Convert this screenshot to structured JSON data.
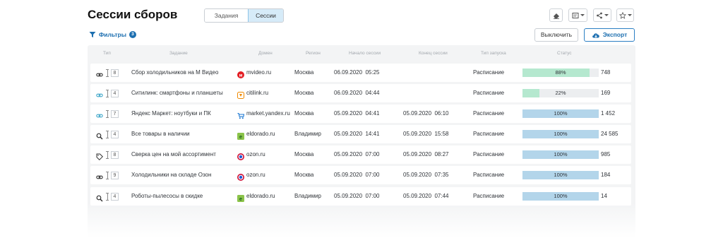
{
  "header": {
    "title": "Сессии сборов",
    "tabs": [
      {
        "label": "Задания",
        "active": false
      },
      {
        "label": "Сессии",
        "active": true
      }
    ]
  },
  "toolbar": {
    "icons": [
      "eraser-icon",
      "columns-icon",
      "share-icon",
      "star-icon"
    ],
    "filters_label": "Фильтры",
    "filters_count": "3",
    "disable_label": "Выключить",
    "export_label": "Экспорт"
  },
  "table": {
    "columns": [
      "Тип",
      "Задание",
      "Домен",
      "Регион",
      "Начало сессии",
      "Конец сессии",
      "Тип запуска",
      "Статус"
    ],
    "rows": [
      {
        "type_icon": "link-icon",
        "count": "8",
        "task": "Сбор холодильников на М Видео",
        "domain": "mvideo.ru",
        "favicon": "mvideo",
        "region": "Москва",
        "start": "06.09.2020  05:25",
        "end": "",
        "launch": "Расписание",
        "progress": 0.88,
        "progress_label": "88%",
        "status_color": "#b5e8cf",
        "items": "748"
      },
      {
        "type_icon": "link-icon",
        "count": "4",
        "task": "Ситилинк: смартфоны и планшеты",
        "domain": "citilink.ru",
        "favicon": "citilink",
        "region": "Москва",
        "start": "06.09.2020  04:44",
        "end": "",
        "launch": "Расписание",
        "progress": 0.22,
        "progress_label": "22%",
        "status_color": "#b5e8cf",
        "items": "169"
      },
      {
        "type_icon": "link-icon",
        "count": "7",
        "task": "Яндекс Маркет: ноутбуки и ПК",
        "domain": "market.yandex.ru",
        "favicon": "yandex",
        "region": "Москва",
        "start": "05.09.2020  04:41",
        "end": "05.09.2020  06:10",
        "launch": "Расписание",
        "progress": 1.0,
        "progress_label": "100%",
        "status_color": "#b3d5ea",
        "items": "1 452"
      },
      {
        "type_icon": "search-icon",
        "count": "4",
        "task": "Все товары в наличии",
        "domain": "eldorado.ru",
        "favicon": "eldorado",
        "region": "Владимир",
        "start": "05.09.2020  14:41",
        "end": "05.09.2020  15:58",
        "launch": "Расписание",
        "progress": 1.0,
        "progress_label": "100%",
        "status_color": "#b3d5ea",
        "items": "24 585"
      },
      {
        "type_icon": "tag-icon",
        "count": "8",
        "task": "Сверка цен на мой ассортимент",
        "domain": "ozon.ru",
        "favicon": "ozon",
        "region": "Москва",
        "start": "05.09.2020  07:00",
        "end": "05.09.2020  08:27",
        "launch": "Расписание",
        "progress": 1.0,
        "progress_label": "100%",
        "status_color": "#b3d5ea",
        "items": "985"
      },
      {
        "type_icon": "link-icon",
        "count": "9",
        "task": "Холодильники на складе Озон",
        "domain": "ozon.ru",
        "favicon": "ozon",
        "region": "Москва",
        "start": "05.09.2020  07:00",
        "end": "05.09.2020  07:35",
        "launch": "Расписание",
        "progress": 1.0,
        "progress_label": "100%",
        "status_color": "#b3d5ea",
        "items": "184"
      },
      {
        "type_icon": "search-icon",
        "count": "4",
        "task": "Роботы-пылесосы в скидке",
        "domain": "eldorado.ru",
        "favicon": "eldorado",
        "region": "Владимир",
        "start": "05.09.2020  07:00",
        "end": "05.09.2020  07:44",
        "launch": "Расписание",
        "progress": 1.0,
        "progress_label": "100%",
        "status_color": "#b3d5ea",
        "items": "14"
      }
    ]
  },
  "colors": {
    "accent": "#1d6fb0",
    "progress_running": "#b5e8cf",
    "progress_done": "#b3d5ea"
  }
}
